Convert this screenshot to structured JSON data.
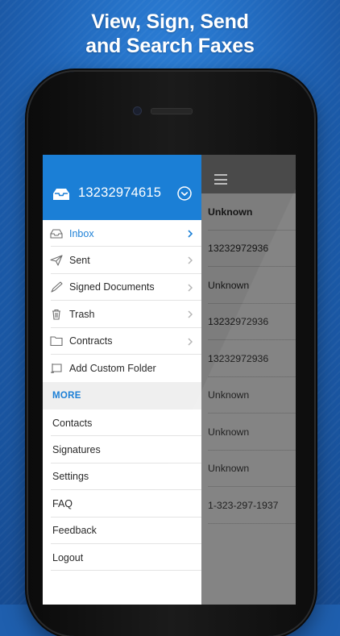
{
  "headline": {
    "line1": "View, Sign, Send",
    "line2": "and Search Faxes"
  },
  "colors": {
    "accent": "#1b7fd6",
    "background": "#1e62b4",
    "overlay": "#7d7d7d"
  },
  "drawer": {
    "account_number": "13232974615",
    "account_icon": "inbox-tray-icon",
    "toggle_icon": "chevron-down-circle-icon",
    "folders": [
      {
        "label": "Inbox",
        "icon": "inbox-icon",
        "active": true,
        "chevron": true
      },
      {
        "label": "Sent",
        "icon": "paper-plane-icon",
        "chevron": true
      },
      {
        "label": "Signed Documents",
        "icon": "pen-icon",
        "chevron": true
      },
      {
        "label": "Trash",
        "icon": "trash-icon",
        "chevron": true
      },
      {
        "label": "Contracts",
        "icon": "folder-icon",
        "chevron": true
      },
      {
        "label": "Add Custom Folder",
        "icon": "add-folder-icon",
        "chevron": false
      }
    ],
    "more_header": "MORE",
    "more_items": [
      "Contacts",
      "Signatures",
      "Settings",
      "FAQ",
      "Feedback",
      "Logout"
    ]
  },
  "content": {
    "menu_icon": "hamburger-menu-icon",
    "faxes": [
      {
        "sender": "Unknown",
        "unread": true
      },
      {
        "sender": "13232972936"
      },
      {
        "sender": "Unknown"
      },
      {
        "sender": "13232972936"
      },
      {
        "sender": "13232972936"
      },
      {
        "sender": "Unknown"
      },
      {
        "sender": "Unknown"
      },
      {
        "sender": "Unknown"
      },
      {
        "sender": "1-323-297-1937"
      }
    ]
  }
}
